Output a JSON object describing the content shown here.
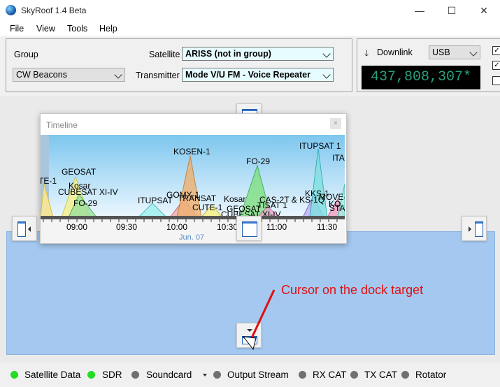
{
  "window": {
    "title": "SkyRoof 1.4 Beta",
    "minimize": "—",
    "maximize": "☐",
    "close": "✕"
  },
  "menu": [
    "File",
    "View",
    "Tools",
    "Help"
  ],
  "group_panel": {
    "group_label": "Group",
    "group_value": "CW Beacons",
    "satellite_label": "Satellite",
    "satellite_value": "ARISS (not in group)",
    "transmitter_label": "Transmitter",
    "transmitter_value": "Mode V/U FM - Voice Repeater"
  },
  "downlink_panel": {
    "label": "Downlink",
    "arrow": "🡓",
    "mode": "USB",
    "frequency": "437,808,307*",
    "check1": "✓",
    "check2": "✓"
  },
  "timeline": {
    "title": "Timeline",
    "close": "×",
    "date": "Jun. 07",
    "ticks": [
      "09:00",
      "09:30",
      "10:00",
      "10:30",
      "11:00",
      "11:30"
    ],
    "sat_labels": [
      "TE-1",
      "GEOSAT",
      "Kosar",
      "CUBESAT XI-IV",
      "FO-29",
      "KOSEN-1",
      "FO-29",
      "ITUPSAT 1",
      "ITA",
      "GOMX-1",
      "TRANSAT",
      "ITUPSAT",
      "CUTE-1",
      "Kosar",
      "GEOSAT",
      "CUBESAT XI-IV",
      "CAS-2T & KS-1Q",
      "TISAT 1",
      "KKS-1",
      "MOVE-",
      "KO",
      "STA"
    ]
  },
  "annotation": "Cursor on the dock target",
  "status": [
    {
      "label": "Satellite Data",
      "color": "#22dd22"
    },
    {
      "label": "SDR",
      "color": "#22dd22"
    },
    {
      "label": "Soundcard",
      "color": "#707070"
    },
    {
      "label": "Output Stream",
      "color": "#707070"
    },
    {
      "label": "RX CAT",
      "color": "#707070"
    },
    {
      "label": "TX CAT",
      "color": "#707070"
    },
    {
      "label": "Rotator",
      "color": "#707070"
    }
  ]
}
